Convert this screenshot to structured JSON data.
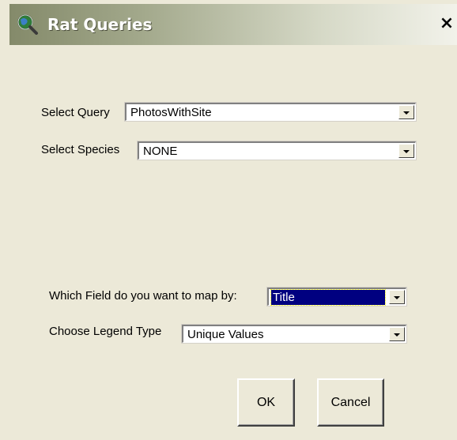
{
  "window": {
    "title": "Rat Queries",
    "title_icon": "map-magnifier-icon",
    "close_label": "×"
  },
  "form": {
    "select_query": {
      "label": "Select Query",
      "value": "PhotosWithSite"
    },
    "select_species": {
      "label": "Select Species",
      "value": "NONE"
    },
    "map_field": {
      "label": "Which Field do you want to map by:",
      "value": "Title"
    },
    "legend_type": {
      "label": "Choose Legend Type",
      "value": "Unique Values"
    }
  },
  "buttons": {
    "ok": "OK",
    "cancel": "Cancel"
  }
}
